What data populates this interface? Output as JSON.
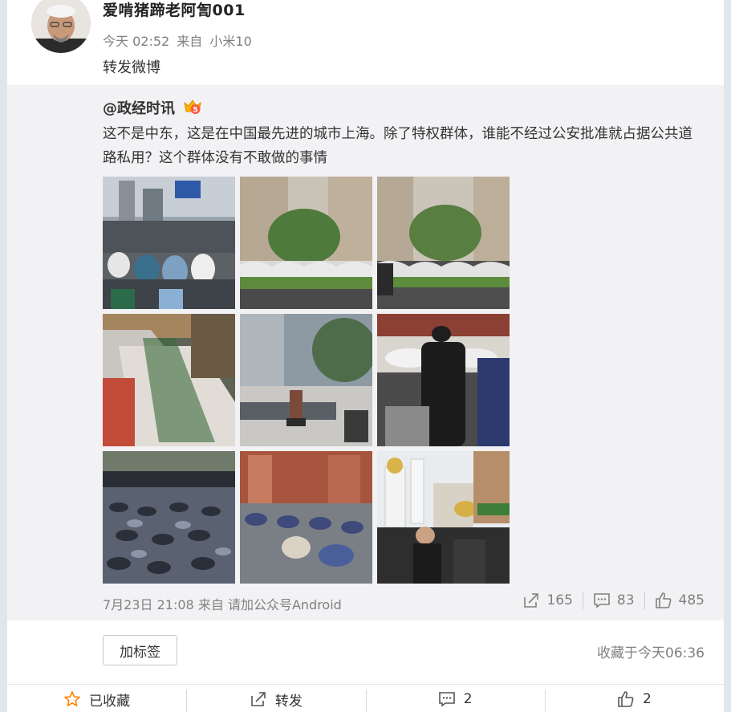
{
  "post": {
    "username": "爱啃猪蹄老阿訇001",
    "time": "今天 02:52",
    "source_prefix": "来自",
    "source": "小米10",
    "text": "转发微博"
  },
  "quoted": {
    "author": "@政经时讯",
    "text": "这不是中东，这是在中国最先进的城市上海。除了特权群体，谁能不经过公安批准就占据公共道路私用？这个群体没有不敢做的事情",
    "time": "7月23日 21:08",
    "source_prefix": "来自",
    "source": "请加公众号Android",
    "reposts": "165",
    "comments": "83",
    "likes": "485",
    "image_count": 9
  },
  "actions": {
    "tag_label": "加标签",
    "favorited_at": "收藏于今天06:36"
  },
  "bottom_bar": {
    "favorite_label": "已收藏",
    "repost_label": "转发",
    "comment_count": "2",
    "like_count": "2"
  },
  "colors": {
    "favorite_star": "#ff8200",
    "meta_gray": "#808080",
    "quoted_bg": "#f2f2f5"
  }
}
